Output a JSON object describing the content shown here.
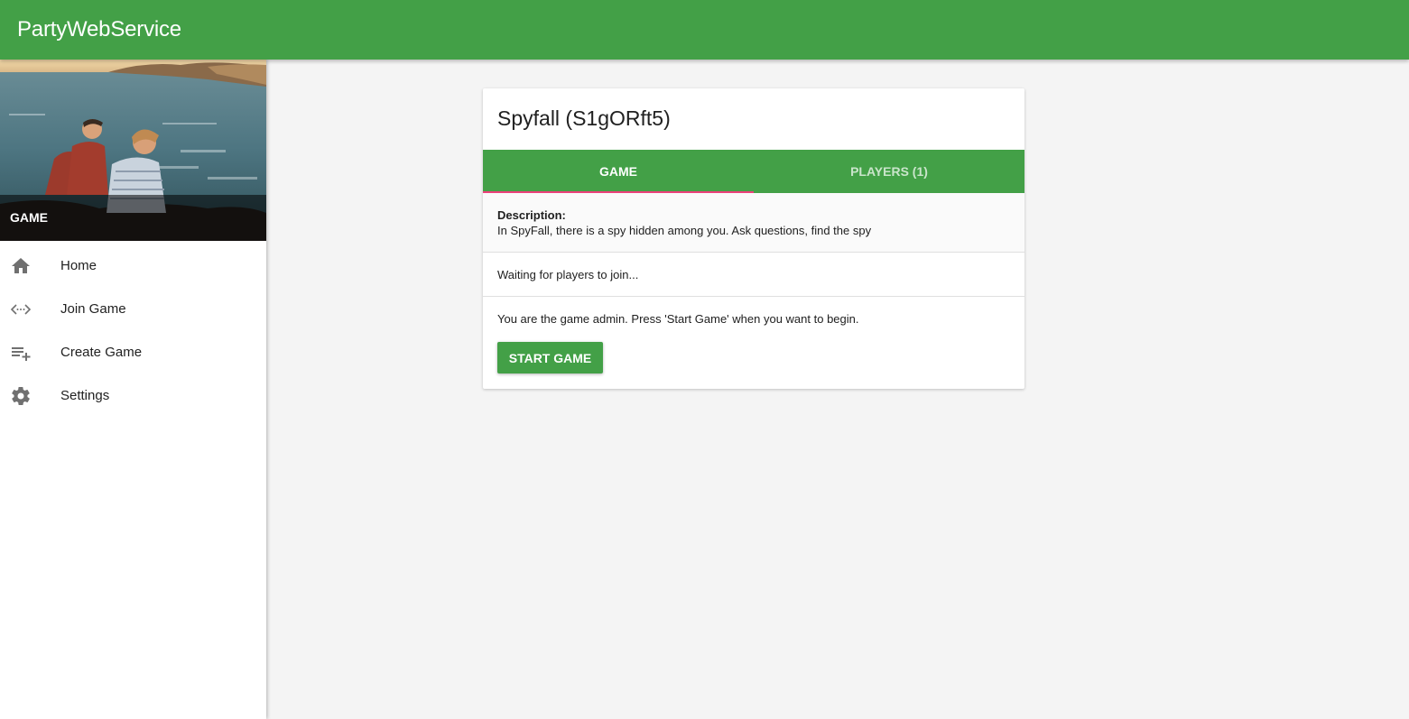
{
  "app": {
    "title": "PartyWebService"
  },
  "sidebar": {
    "header_title": "GAME",
    "items": [
      {
        "label": "Home",
        "icon": "home-icon"
      },
      {
        "label": "Join Game",
        "icon": "join-code-icon"
      },
      {
        "label": "Create Game",
        "icon": "playlist-add-icon"
      },
      {
        "label": "Settings",
        "icon": "gear-icon"
      }
    ]
  },
  "game": {
    "title": "Spyfall (S1gORft5)",
    "tabs": [
      {
        "label": "GAME",
        "active": true
      },
      {
        "label": "PLAYERS (1)",
        "active": false
      }
    ],
    "description_label": "Description:",
    "description_text": "In SpyFall, there is a spy hidden among you. Ask questions, find the spy",
    "status_text": "Waiting for players to join...",
    "admin_text": "You are the game admin. Press 'Start Game' when you want to begin.",
    "start_button": "START GAME"
  },
  "colors": {
    "primary": "#43a047",
    "tab_indicator": "#ec407a",
    "background": "#f4f4f4"
  }
}
